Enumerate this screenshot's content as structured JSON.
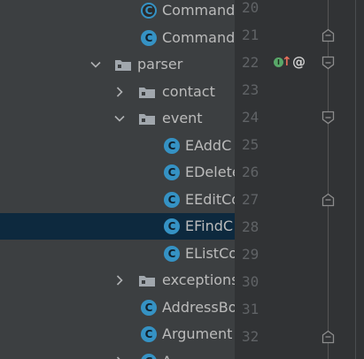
{
  "colors": {
    "tree_bg": "#3c3f41",
    "gutter_bg": "#313335",
    "selection": "#0d293e",
    "class_icon": "#3592c4",
    "text": "#bbbbbb",
    "line_number": "#606366",
    "implements_marker": "#59a869",
    "override_marker": "#e76f5b"
  },
  "project_tree": {
    "rows": [
      {
        "label": "Command",
        "icon": "abstract-class-icon",
        "arrow": "none"
      },
      {
        "label": "Command",
        "icon": "class-icon",
        "arrow": "none"
      },
      {
        "label": "parser",
        "icon": "package-folder-icon",
        "arrow": "expanded"
      },
      {
        "label": "contact",
        "icon": "package-folder-icon",
        "arrow": "collapsed"
      },
      {
        "label": "event",
        "icon": "package-folder-icon",
        "arrow": "expanded"
      },
      {
        "label": "EAddC",
        "icon": "class-icon",
        "arrow": "none"
      },
      {
        "label": "EDelete",
        "icon": "class-icon",
        "arrow": "none"
      },
      {
        "label": "EEditCo",
        "icon": "class-icon",
        "arrow": "none"
      },
      {
        "label": "EFindC",
        "icon": "class-icon",
        "arrow": "none",
        "selected": true
      },
      {
        "label": "EListCo",
        "icon": "class-icon",
        "arrow": "none"
      },
      {
        "label": "exceptions",
        "icon": "package-folder-icon",
        "arrow": "collapsed"
      },
      {
        "label": "AddressBo",
        "icon": "class-icon",
        "arrow": "none"
      },
      {
        "label": "Argument",
        "icon": "class-icon",
        "arrow": "none"
      },
      {
        "label": "A",
        "icon": "class-icon",
        "arrow": "collapsed"
      }
    ]
  },
  "gutter": {
    "line_numbers": [
      "20",
      "21",
      "22",
      "23",
      "24",
      "25",
      "26",
      "27",
      "28",
      "29",
      "30",
      "31",
      "32"
    ],
    "annotation_line": "22",
    "implements_glyph": "I",
    "override_glyph": "↑",
    "annotation_glyph": "@",
    "fold_marker_lines": [
      "21",
      "22",
      "24",
      "27",
      "32"
    ]
  }
}
